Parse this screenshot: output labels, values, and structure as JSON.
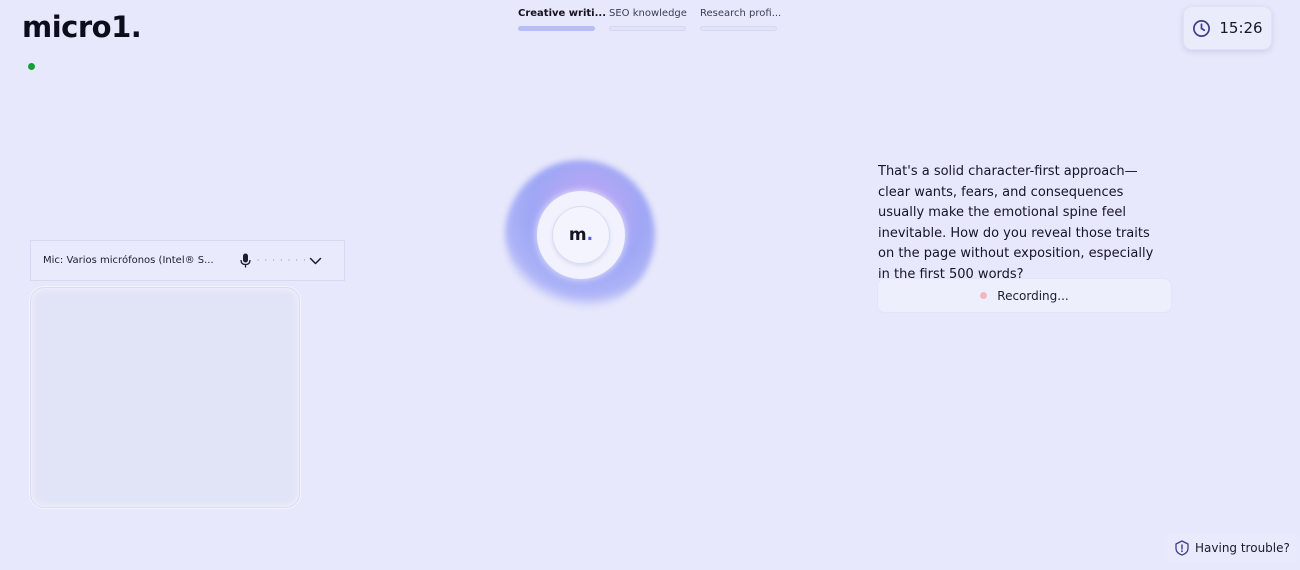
{
  "brand": {
    "logo_text": "micro1.",
    "orb_logo_letter": "m",
    "orb_logo_dot": ".",
    "accent_color": "#5a5fe0"
  },
  "tabs": [
    {
      "label": "Creative writi...",
      "active": true
    },
    {
      "label": "SEO knowledge",
      "active": false
    },
    {
      "label": "Research profi...",
      "active": false
    }
  ],
  "timer": {
    "icon": "clock-icon",
    "value": "15:26"
  },
  "connection_status": {
    "color": "#12a136"
  },
  "mic": {
    "label": "Mic: Varios micrófonos (Intel® S...",
    "icon": "microphone-icon",
    "level_indicator": "· · · · · · ·",
    "dropdown_icon": "chevron-down-icon"
  },
  "message": {
    "text": "That's a solid character-first approach—clear wants, fears, and consequences usually make the emotional spine feel inevitable. How do you reveal those traits on the page without exposition, especially in the first 500 words?"
  },
  "recording": {
    "label": "Recording...",
    "dot_color": "#f3b7c4"
  },
  "help": {
    "label": "Having trouble?",
    "icon": "info-shield-icon"
  }
}
